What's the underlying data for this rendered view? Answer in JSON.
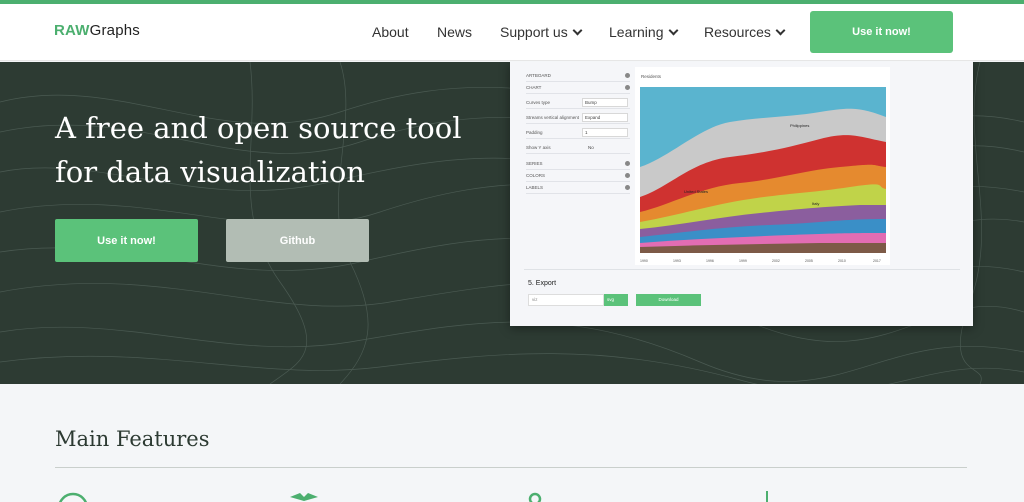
{
  "header": {
    "logo_raw": "RAW",
    "logo_graphs": "Graphs",
    "nav": [
      {
        "label": "About",
        "dropdown": false
      },
      {
        "label": "News",
        "dropdown": false
      },
      {
        "label": "Support us",
        "dropdown": true
      },
      {
        "label": "Learning",
        "dropdown": true
      },
      {
        "label": "Resources",
        "dropdown": true
      }
    ],
    "cta_label": "Use it now!"
  },
  "hero": {
    "headline": "A free and open source tool for data visualization",
    "primary_button": "Use it now!",
    "secondary_button": "Github"
  },
  "preview": {
    "panel": [
      {
        "label": "ARTBOARD",
        "type": "section"
      },
      {
        "label": "CHART",
        "type": "section"
      },
      {
        "label": "Curves type",
        "value": "Bump"
      },
      {
        "label": "Streams vertical alignment",
        "value": "Expand"
      },
      {
        "label": "Padding",
        "value": "1"
      },
      {
        "label": "Show Y axis",
        "value": "No"
      },
      {
        "label": "SERIES",
        "type": "section"
      },
      {
        "label": "COLORS",
        "type": "section"
      },
      {
        "label": "LABELS",
        "type": "section"
      }
    ],
    "chart_title": "Residents",
    "stream_labels": [
      "Philippines",
      "United States",
      "Italy"
    ],
    "x_ticks": [
      "1990",
      "1993",
      "1996",
      "1999",
      "2002",
      "2005",
      "2010",
      "2017"
    ],
    "export_title": "5. Export",
    "export_placeholder": "viz",
    "export_format": "svg",
    "download_label": "Download"
  },
  "features": {
    "title": "Main Features"
  },
  "colors": {
    "accent": "#5bc27a",
    "hero_bg": "#2d3b33",
    "page_bg": "#f4f6f8"
  }
}
